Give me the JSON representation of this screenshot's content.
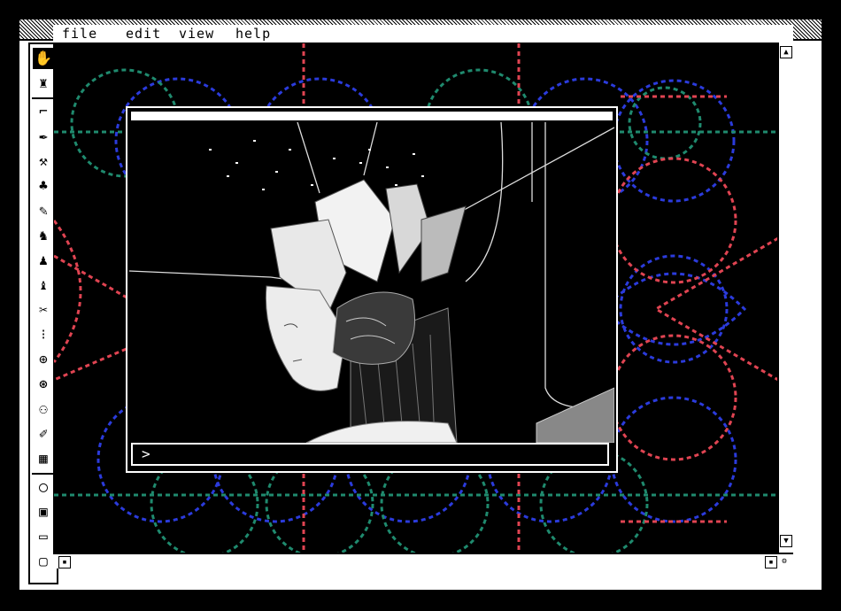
{
  "menu": {
    "file": "file",
    "edit": "edit",
    "view": "view",
    "help": "help"
  },
  "tools": [
    "hand-tool-icon",
    "pointer-icon",
    "selection-icon",
    "lasso-icon",
    "brush-icon",
    "spray-icon",
    "pencil-icon",
    "bucket-icon",
    "figure-icon",
    "eraser-icon",
    "knife-icon",
    "grid-icon",
    "target-icon",
    "circle-tool-icon",
    "crowd-icon",
    "pen-icon",
    "pattern-icon",
    "oval-icon",
    "book-icon",
    "tag-icon",
    "monitor-icon"
  ],
  "prompt": {
    "text": ">"
  },
  "colors": {
    "blue": "#2b3bdc",
    "green": "#1f8a6e",
    "red": "#e04452",
    "background": "#000000",
    "chrome": "#ffffff"
  }
}
